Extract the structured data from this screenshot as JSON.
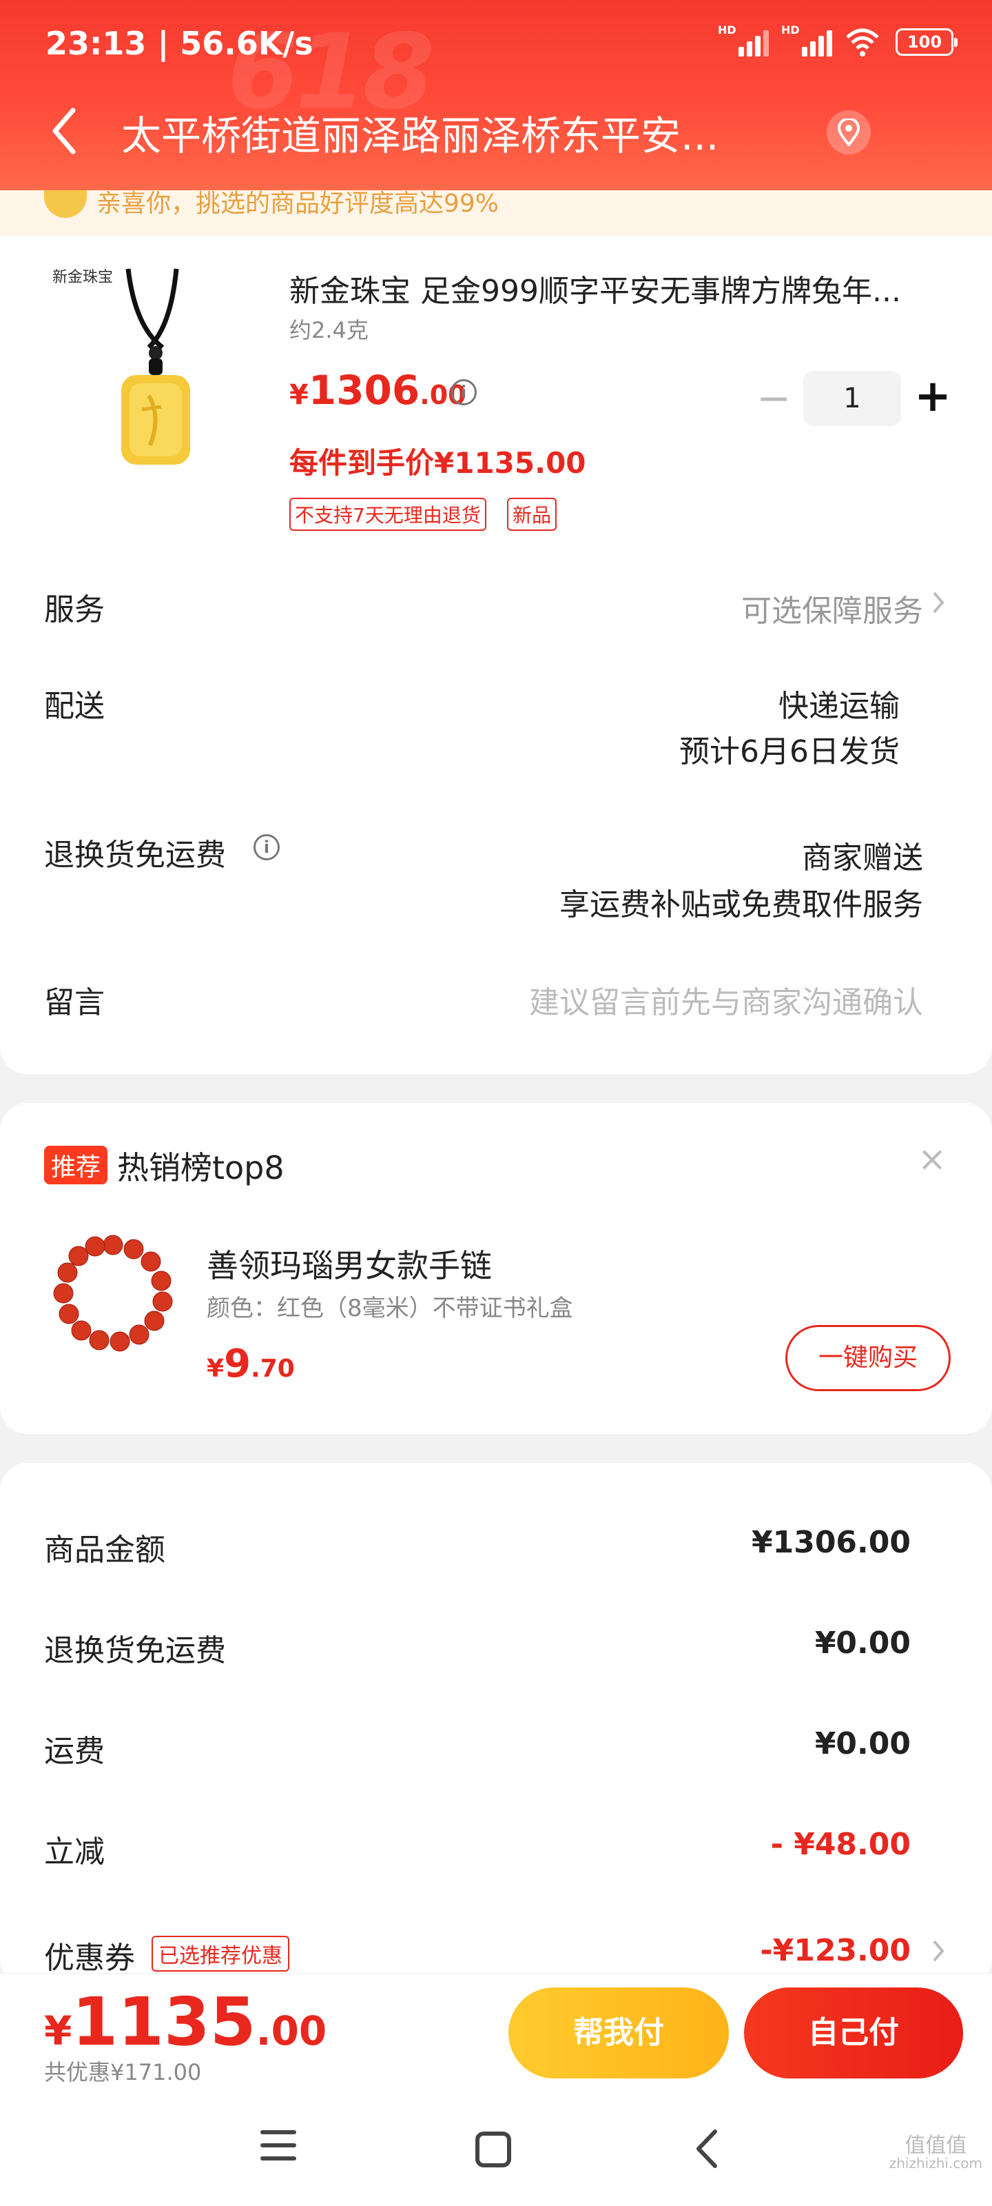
{
  "status_bar": {
    "time": "23:13 | 56.6K/s",
    "battery": "100",
    "hd1": "HD",
    "hd2": "HD"
  },
  "header": {
    "address": "太平桥街道丽泽路丽泽桥东平安...",
    "banner_deco": "618"
  },
  "notice": {
    "text": "亲喜你，挑选的商品好评度高达99%"
  },
  "product": {
    "brand_logo": "新金珠宝",
    "title": "新金珠宝 足金999顺字平安无事牌方牌兔年...",
    "weight": "约2.4克",
    "price_currency": "¥",
    "price_int": "1306",
    "price_dec": ".00",
    "unit_price": "每件到手价¥1135.00",
    "quantity": "1",
    "tags": [
      "不支持7天无理由退货",
      "新品"
    ]
  },
  "order_rows": {
    "service_label": "服务",
    "service_value": "可选保障服务",
    "delivery_label": "配送",
    "delivery_value": "快递运输",
    "delivery_eta": "预计6月6日发货",
    "return_label": "退换货免运费",
    "return_value": "商家赠送",
    "return_desc": "享运费补贴或免费取件服务",
    "message_label": "留言",
    "message_placeholder": "建议留言前先与商家沟通确认"
  },
  "recommend": {
    "badge": "推荐",
    "title": "热销榜top8",
    "close": "×",
    "item_name": "善领玛瑙男女款手链",
    "item_spec": "颜色：红色（8毫米）不带证书礼盒",
    "price_currency": "¥",
    "price_int": "9",
    "price_dec": ".70",
    "buy_label": "一键购买"
  },
  "summary": {
    "goods_label": "商品金额",
    "goods_value": "¥1306.00",
    "return_label": "退换货免运费",
    "return_value": "¥0.00",
    "shipping_label": "运费",
    "shipping_value": "¥0.00",
    "instant_label": "立减",
    "instant_value": "- ¥48.00",
    "coupon_label": "优惠券",
    "coupon_tag": "已选推荐优惠",
    "coupon_value": "-¥123.00"
  },
  "bottom_bar": {
    "total_currency": "¥",
    "total_int": "1135",
    "total_dec": ".00",
    "discount_text": "共优惠¥171.00",
    "help_pay_label": "帮我付",
    "self_pay_label": "自己付"
  },
  "watermark": {
    "main": "值值值",
    "sub": "zhizhizhi.com"
  },
  "colors": {
    "accent": "#e8281e",
    "header": "#ff4b3a",
    "help_pay": "#ffc21e"
  }
}
